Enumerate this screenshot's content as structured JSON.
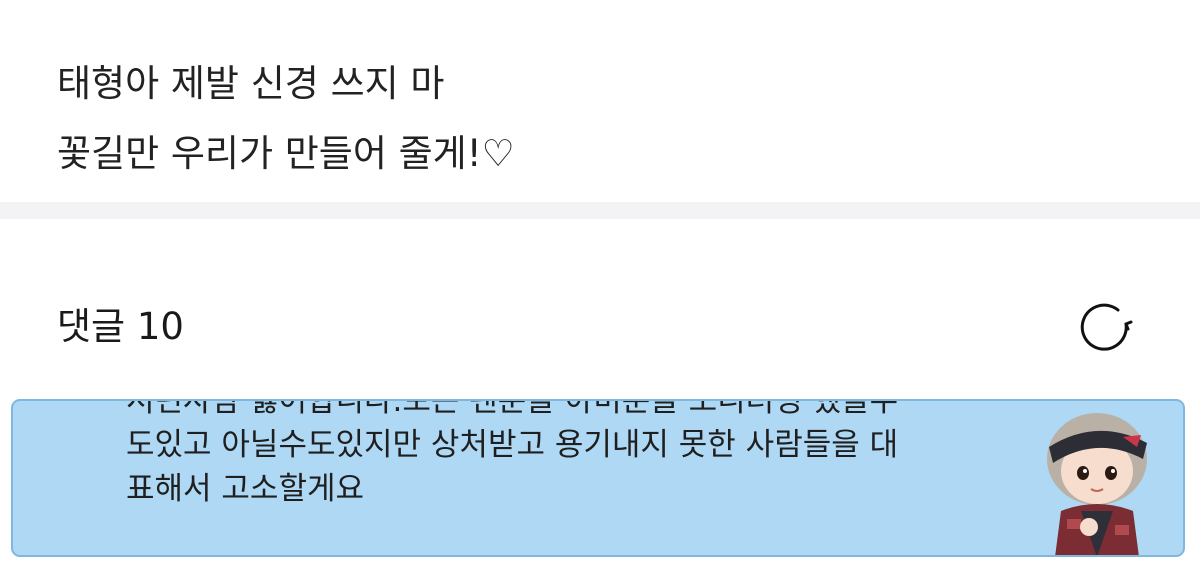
{
  "post": {
    "line1": "태형아 제발 신경 쓰지 마",
    "line2": "꽃길만 우리가 만들어 줄게!♡"
  },
  "comments": {
    "title": "댓글 10",
    "refresh_icon": "refresh-icon"
  },
  "comment": {
    "text": "서턴사람 싫어합니다.보는 팬분들 아미분들 모니터링 했을수\n도있고 아닐수도있지만 상처받고 용기내지 못한 사람들을 대\n표해서 고소할게요",
    "sticker_icon": "character-sticker",
    "background_color": "#aed8f4"
  }
}
